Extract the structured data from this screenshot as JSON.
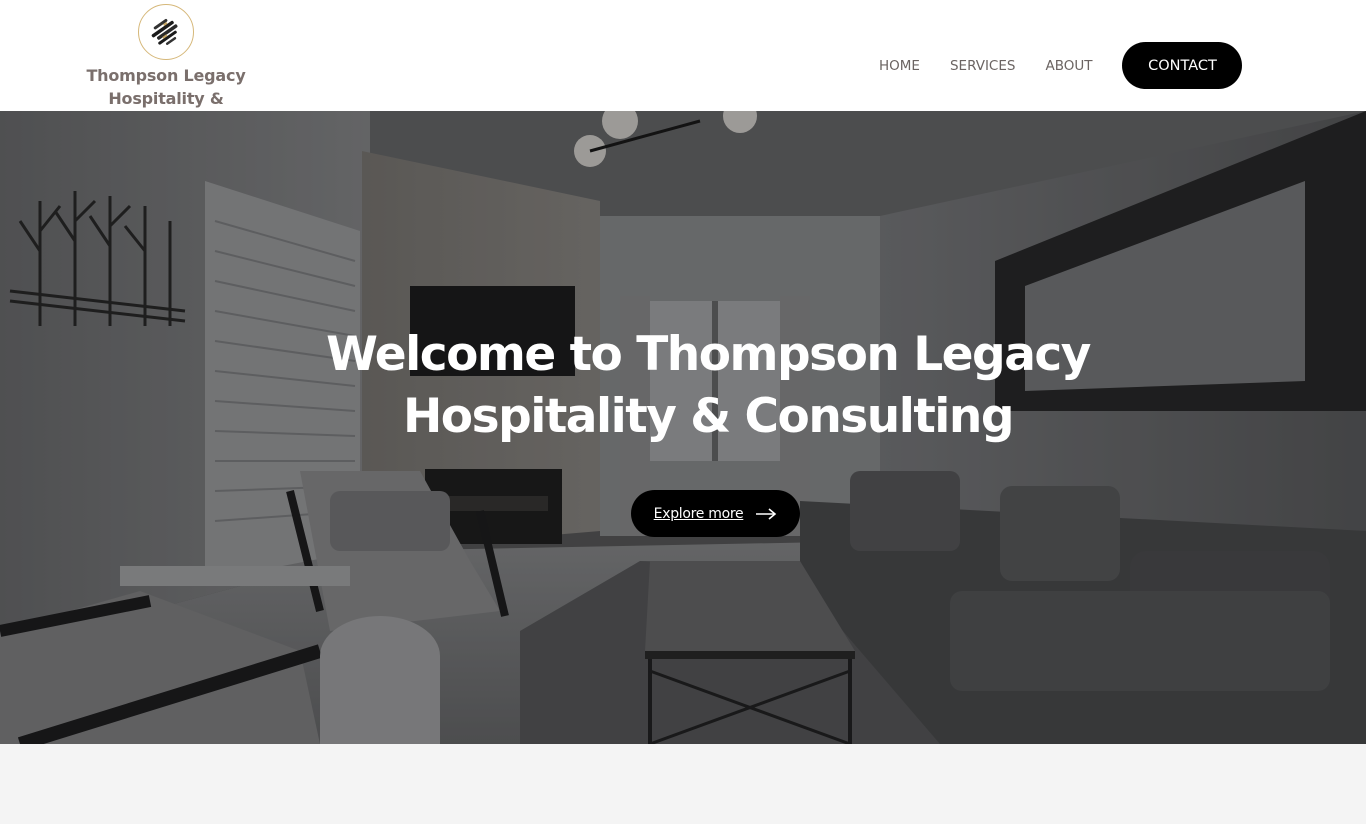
{
  "brand": {
    "line1": "Thompson Legacy",
    "line2": "Hospitality & Consulting",
    "logo_icon": "brushstroke-emblem-icon",
    "accent_ring": "#d6b87a",
    "text_color": "#7a6f6c"
  },
  "nav": {
    "items": [
      {
        "label": "HOME"
      },
      {
        "label": "SERVICES"
      },
      {
        "label": "ABOUT"
      }
    ],
    "contact_label": "CONTACT"
  },
  "hero": {
    "title_line1": "Welcome to Thompson Legacy",
    "title_line2": "Hospitality & Consulting",
    "button_label": "Explore more",
    "button_icon": "arrow-right-icon"
  },
  "colors": {
    "primary_button": "#000000",
    "page_bg": "#f4f4f4"
  }
}
